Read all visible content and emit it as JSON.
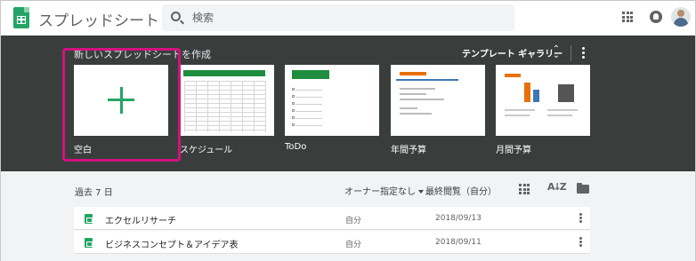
{
  "header": {
    "app_title": "スプレッドシート",
    "search_placeholder": "検索"
  },
  "gallery": {
    "title": "新しいスプレッドシートを作成",
    "gallery_link": "テンプレート ギャラリー",
    "templates": [
      {
        "label": "空白"
      },
      {
        "label": "スケジュール"
      },
      {
        "label": "ToDo"
      },
      {
        "label": "年間予算"
      },
      {
        "label": "月間予算"
      }
    ]
  },
  "list": {
    "section_label": "過去 7 日",
    "owner_filter": "オーナー指定なし",
    "sort_label": "最終閲覧（自分）",
    "files": [
      {
        "name": "エクセルリサーチ",
        "owner": "自分",
        "date": "2018/09/13"
      },
      {
        "name": "ビジネスコンセプト＆アイデア表",
        "owner": "自分",
        "date": "2018/09/11"
      }
    ]
  },
  "colors": {
    "brand_green": "#23a566",
    "highlight": "#d2127f",
    "gallery_bg": "#393e3c"
  }
}
